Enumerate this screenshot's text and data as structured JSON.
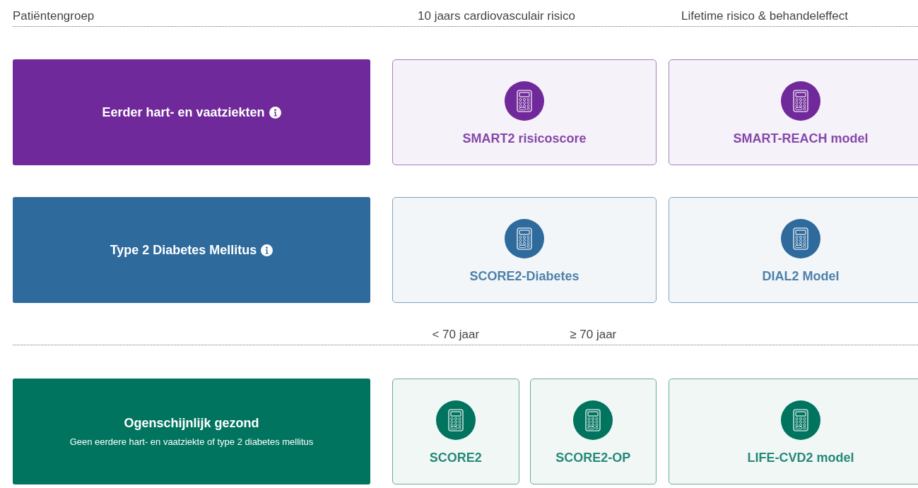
{
  "header": {
    "columns": [
      "Patiëntengroep",
      "10 jaars cardiovasculair risico",
      "Lifetime risico & behandeleffect"
    ]
  },
  "groups": [
    {
      "title": "Eerder hart- en vaatziekten",
      "info": true,
      "color": "#70299a",
      "ten_year": [
        {
          "label": "SMART2 risicoscore"
        }
      ],
      "lifetime": [
        {
          "label": "SMART-REACH model"
        }
      ]
    },
    {
      "title": "Type 2 Diabetes Mellitus",
      "info": true,
      "color": "#2e6a9c",
      "ten_year": [
        {
          "label": "SCORE2-Diabetes"
        }
      ],
      "lifetime": [
        {
          "label": "DIAL2 Model"
        }
      ]
    },
    {
      "title": "Ogenschijnlijk gezond",
      "subtitle": "Geen eerdere hart- en vaatziekte of type 2 diabetes mellitus",
      "info": false,
      "color": "#00745f",
      "age_header": [
        "< 70 jaar",
        "≥ 70 jaar"
      ],
      "ten_year": [
        {
          "label": "SCORE2"
        },
        {
          "label": "SCORE2-OP"
        }
      ],
      "lifetime": [
        {
          "label": "LIFE-CVD2 model"
        }
      ]
    }
  ]
}
